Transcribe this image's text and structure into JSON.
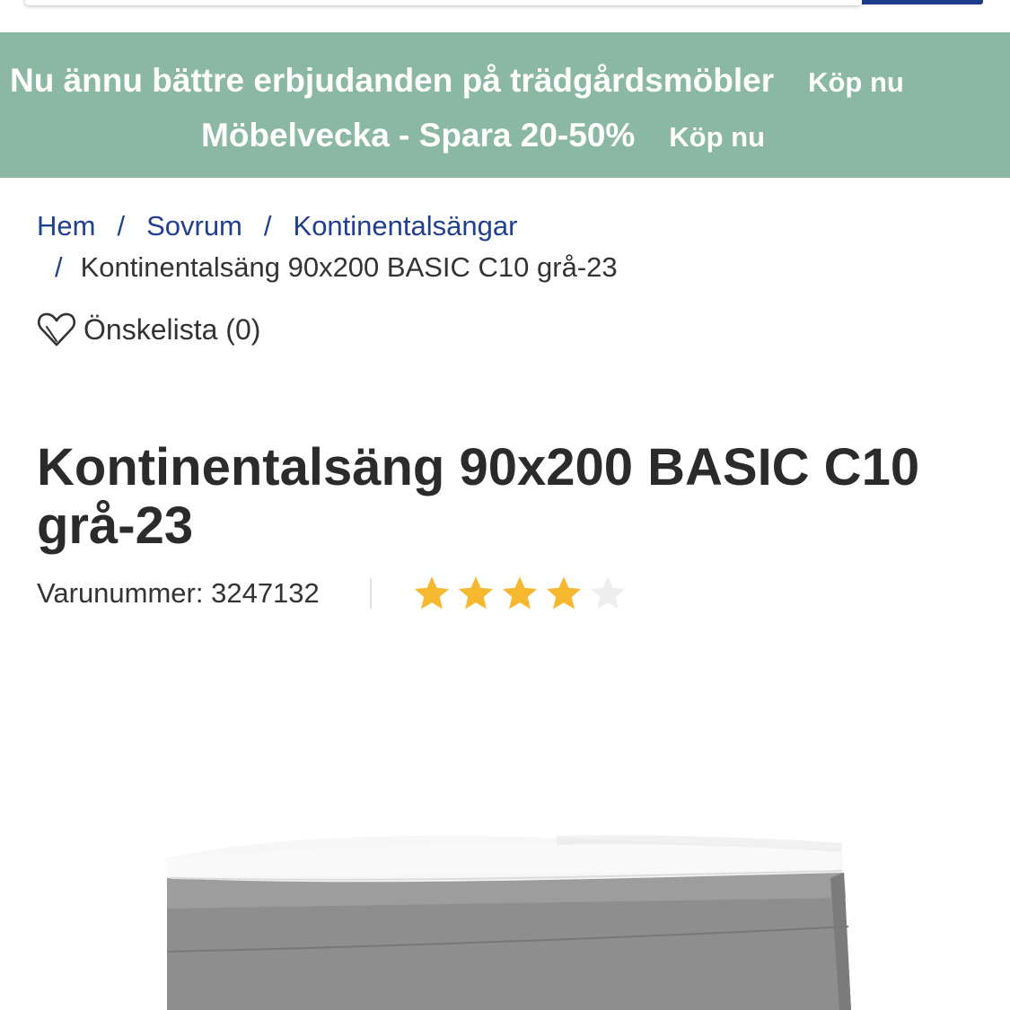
{
  "promo": {
    "line1_text": "Nu ännu bättre erbjudanden på trädgårdsmöbler",
    "line1_link": "Köp nu",
    "line2_text": "Möbelvecka - Spara 20-50%",
    "line2_link": "Köp nu",
    "background": "#8bb8a4"
  },
  "breadcrumb": {
    "items": [
      "Hem",
      "Sovrum",
      "Kontinentalsängar"
    ],
    "separator": "/",
    "current": "Kontinentalsäng 90x200 BASIC C10 grå-23"
  },
  "wishlist": {
    "label": "Önskelista (0)",
    "icon": "heart-outline-icon"
  },
  "product": {
    "title": "Kontinentalsäng 90x200 BASIC C10 grå-23",
    "sku_label": "Varunummer: 3247132",
    "rating": 4,
    "rating_max": 5,
    "star_color": "#f5b82e",
    "star_empty_color": "#eeeeee"
  },
  "colors": {
    "link": "#1f3f8f",
    "search_button": "#1e3c8c"
  }
}
